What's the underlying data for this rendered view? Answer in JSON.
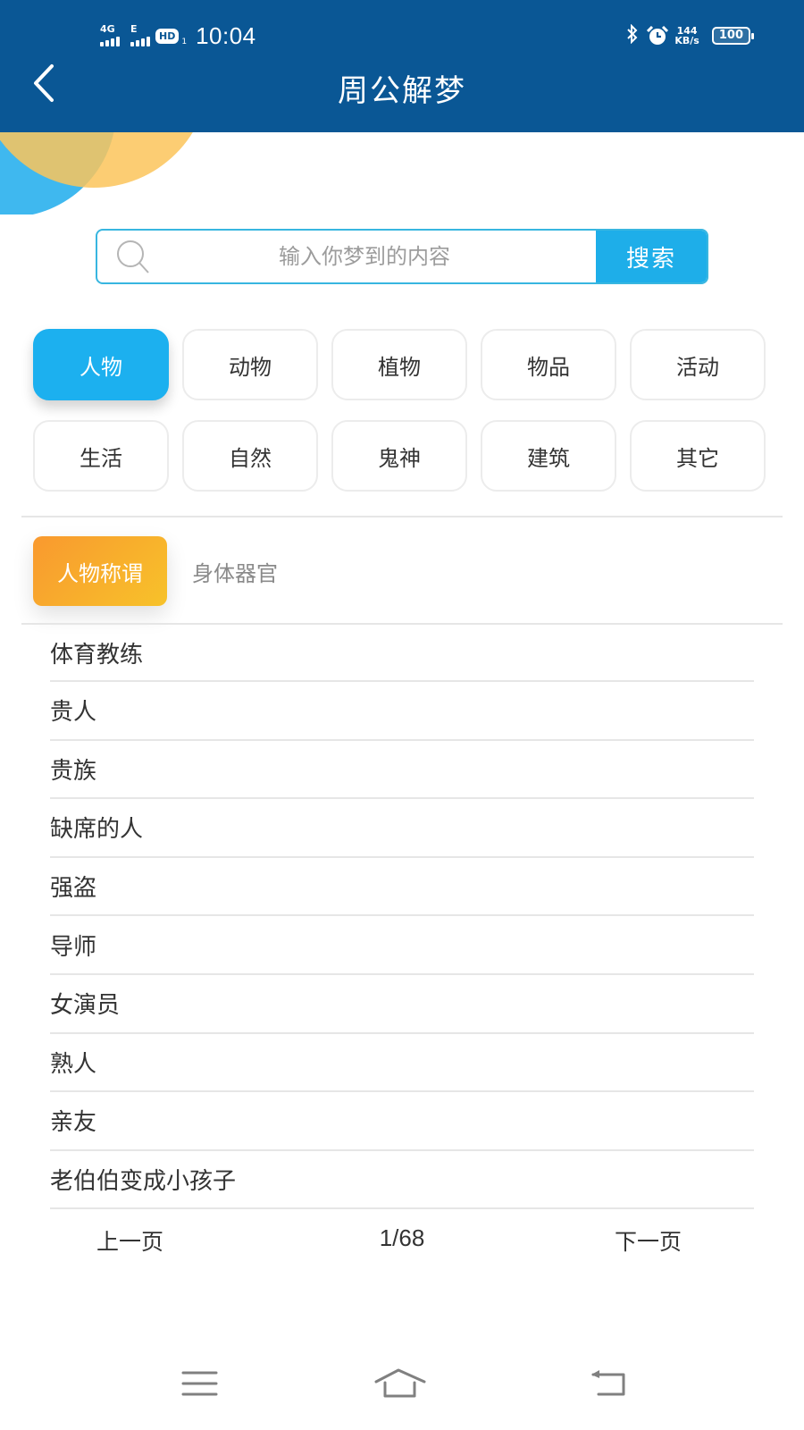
{
  "status_bar": {
    "network_1": "4G",
    "network_2": "E",
    "hd_badge": "HD",
    "hd_sub": "1",
    "time": "10:04",
    "bluetooth": "bluetooth-icon",
    "alarm": "alarm-icon",
    "speed_value": "144",
    "speed_unit": "KB/s",
    "battery": "100"
  },
  "header": {
    "title": "周公解梦",
    "back_icon": "chevron-left-icon"
  },
  "search": {
    "placeholder": "输入你梦到的内容",
    "value": "",
    "button_label": "搜索",
    "icon": "search-icon"
  },
  "categories": [
    {
      "label": "人物",
      "active": true
    },
    {
      "label": "动物",
      "active": false
    },
    {
      "label": "植物",
      "active": false
    },
    {
      "label": "物品",
      "active": false
    },
    {
      "label": "活动",
      "active": false
    },
    {
      "label": "生活",
      "active": false
    },
    {
      "label": "自然",
      "active": false
    },
    {
      "label": "鬼神",
      "active": false
    },
    {
      "label": "建筑",
      "active": false
    },
    {
      "label": "其它",
      "active": false
    }
  ],
  "subtabs": [
    {
      "label": "人物称谓",
      "active": true
    },
    {
      "label": "身体器官",
      "active": false
    }
  ],
  "list": [
    "体育教练",
    "贵人",
    "贵族",
    "缺席的人",
    "强盗",
    "导师",
    "女演员",
    "熟人",
    "亲友",
    "老伯伯变成小孩子"
  ],
  "pager": {
    "prev_label": "上一页",
    "page_indicator": "1/68",
    "next_label": "下一页"
  },
  "system_nav": {
    "menu": "menu-icon",
    "home": "home-icon",
    "back": "back-icon"
  },
  "colors": {
    "header_bg": "#0a5795",
    "accent_blue": "#1cb0ef",
    "subtab_gradient_start": "#f9992f",
    "subtab_gradient_end": "#f7c22a"
  }
}
